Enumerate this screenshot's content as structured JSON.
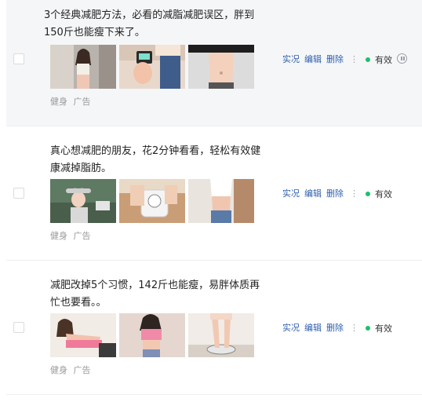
{
  "items": [
    {
      "title": "3个经典减肥方法，必看的减脂减肥误区，胖到150斤也能瘦下来了。",
      "thumbnails": [
        "fitness-photo-woman-mirror",
        "fitness-photo-scale-hand",
        "fitness-photo-waist"
      ],
      "tags": [
        "健身",
        "广告"
      ],
      "actions": {
        "live": "实况",
        "edit": "编辑",
        "delete": "删除"
      },
      "status": "有效",
      "status_color": "#1bc16b"
    },
    {
      "title": "真心想减肥的朋友，花2分钟看看，轻松有效健康减掉脂肪。",
      "thumbnails": [
        "fitness-photo-woman-hat",
        "fitness-photo-scale-feet",
        "fitness-photo-waist-kitchen"
      ],
      "tags": [
        "健身",
        "广告"
      ],
      "actions": {
        "live": "实况",
        "edit": "编辑",
        "delete": "删除"
      },
      "status": "有效",
      "status_color": "#1bc16b"
    },
    {
      "title": "减肥改掉5个习惯，142斤也能瘦，易胖体质再忙也要看。。",
      "thumbnails": [
        "fitness-photo-woman-pink-top",
        "fitness-photo-woman-tank",
        "fitness-photo-scale-legs"
      ],
      "tags": [
        "健身",
        "广告"
      ],
      "actions": {
        "live": "实况",
        "edit": "编辑",
        "delete": "删除"
      },
      "status": "有效",
      "status_color": "#1bc16b"
    }
  ],
  "colors": {
    "link": "#2f5fad",
    "status_green": "#1bc16b",
    "hover_row": "#f5f6f8"
  }
}
